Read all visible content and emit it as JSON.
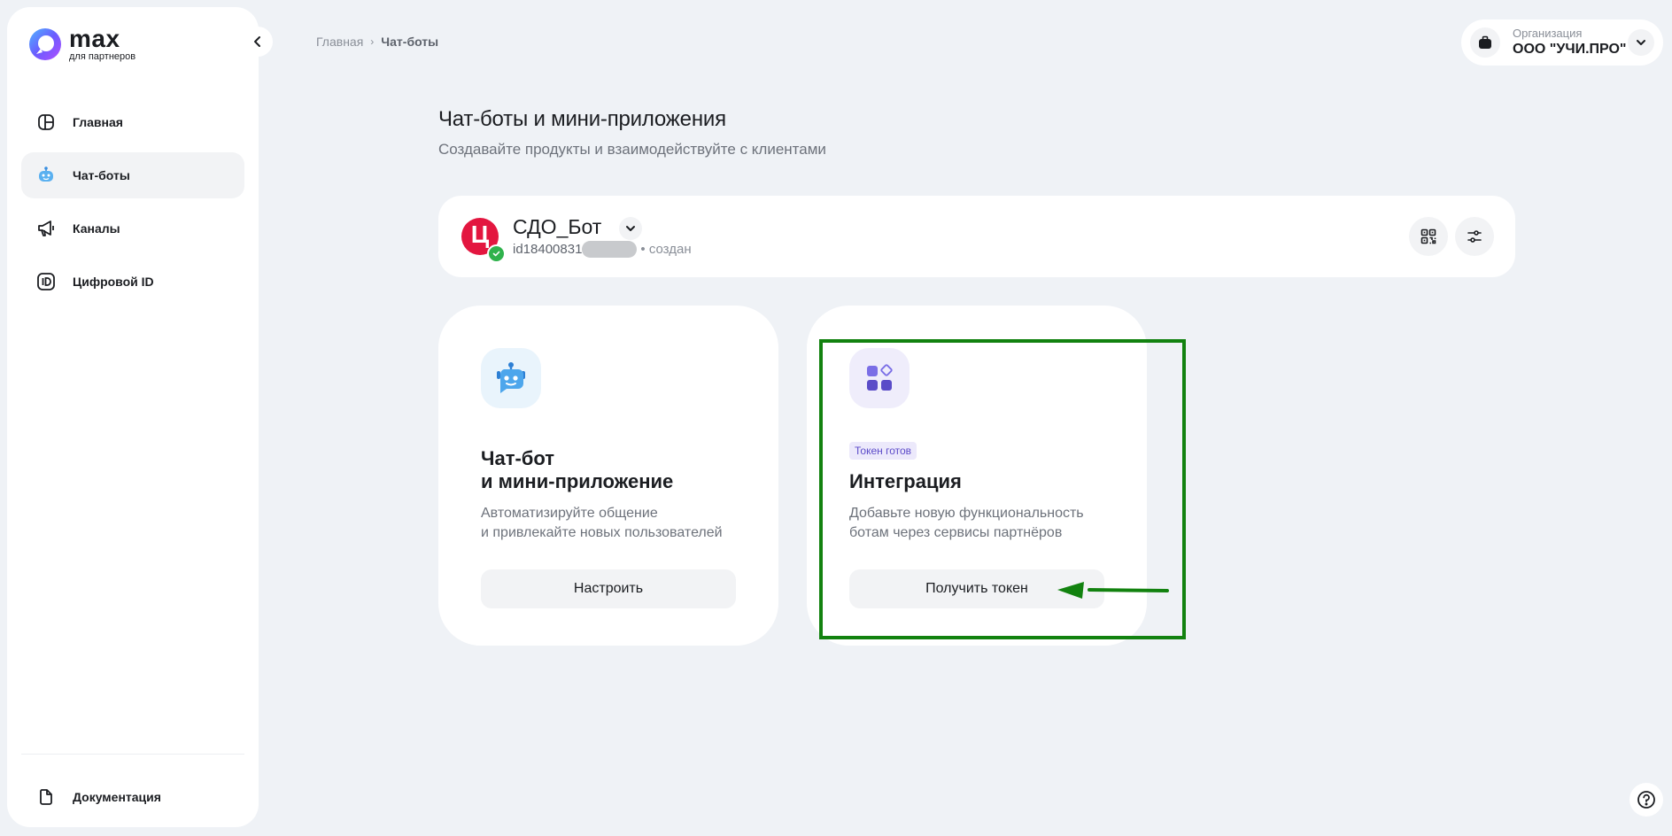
{
  "sidebar": {
    "logo_word": "max",
    "logo_sub": "для партнеров",
    "items": [
      {
        "label": "Главная",
        "icon": "home-icon",
        "active": false
      },
      {
        "label": "Чат-боты",
        "icon": "robot-icon",
        "active": true
      },
      {
        "label": "Каналы",
        "icon": "megaphone-icon",
        "active": false
      },
      {
        "label": "Цифровой ID",
        "icon": "id-icon",
        "active": false
      }
    ],
    "documentation": "Документация"
  },
  "breadcrumb": {
    "home": "Главная",
    "current": "Чат-боты"
  },
  "organization": {
    "label": "Организация",
    "name": "ООО \"УЧИ.ПРО\""
  },
  "page": {
    "title": "Чат-боты и мини-приложения",
    "subtitle": "Создавайте продукты и взаимодействуйте с клиентами"
  },
  "bot": {
    "avatar_letter": "Ц",
    "name": "СДО_Бот",
    "id_prefix": "id18400831",
    "status": "• создан"
  },
  "tiles": [
    {
      "title_line1": "Чат-бот",
      "title_line2": "и мини-приложение",
      "desc_line1": "Автоматизируйте общение",
      "desc_line2": "и привлекайте новых пользователей",
      "button": "Настроить"
    },
    {
      "badge": "Токен готов",
      "title": "Интеграция",
      "desc_line1": "Добавьте новую функциональность",
      "desc_line2": "ботам через сервисы партнёров",
      "button": "Получить токен"
    }
  ],
  "colors": {
    "accent_highlight": "#12820f",
    "bot_avatar": "#e3163f",
    "badge_text": "#5c4bc9",
    "background": "#eff2f6"
  }
}
